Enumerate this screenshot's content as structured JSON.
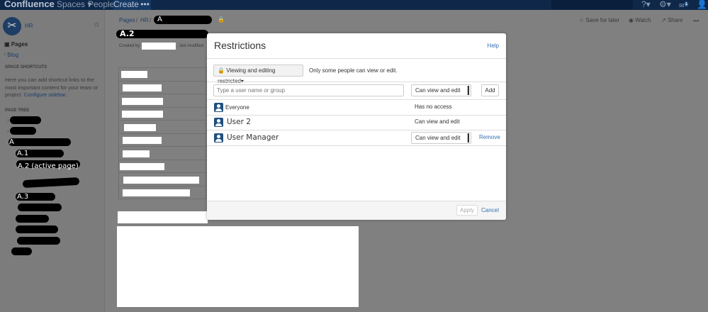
{
  "topbar": {
    "logo": "Confluence",
    "spaces": "Spaces ▾",
    "people": "People",
    "create": "Create",
    "more": "•••",
    "notifications_count": "1"
  },
  "sidebar": {
    "space_name": "HR",
    "pages": "Pages",
    "blog": "Blog",
    "shortcuts_heading": "SPACE SHORTCUTS",
    "shortcuts_text": "Here you can add shortcut links to the most important content for your team or project.",
    "configure_link": "Configure sidebar",
    "page_tree_heading": "PAGE TREE",
    "tree": [
      "A",
      "A.1",
      "A.2 (active page)",
      "A.3"
    ]
  },
  "page": {
    "breadcrumb": [
      "Pages",
      "HR",
      "A"
    ],
    "title": "A.2",
    "created_by": "Created by",
    "last_modified": ", last modified",
    "actions": {
      "save": "Save for later",
      "watch": "Watch",
      "share": "Share",
      "more": "•••"
    }
  },
  "dialog": {
    "title": "Restrictions",
    "help": "Help",
    "restriction_mode": "Viewing and editing restricted",
    "restriction_desc": "Only some people can view or edit.",
    "input_placeholder": "Type a user name or group",
    "permission_select": "Can view and edit",
    "add": "Add",
    "entries": [
      {
        "name": "Everyone",
        "permission": "Has no access"
      },
      {
        "name": "User 2",
        "permission": "Can view and edit"
      },
      {
        "name": "User Manager",
        "permission": "Can view and edit",
        "remove": "Remove"
      }
    ],
    "apply": "Apply",
    "cancel": "Cancel"
  }
}
